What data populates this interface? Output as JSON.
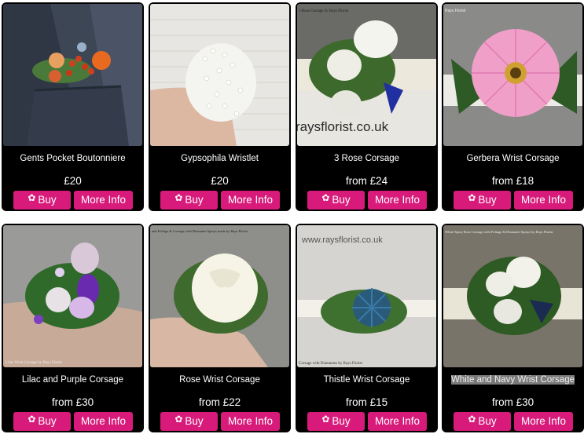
{
  "colors": {
    "accent": "#d81b7b",
    "card": "#000000",
    "text": "#ffffff"
  },
  "products": [
    {
      "name": "Gents Pocket Boutonniere",
      "price": "£20",
      "buy_label": "Buy",
      "info_label": "More Info",
      "buy_icon": "flower-cart-icon",
      "image_caption": ""
    },
    {
      "name": "Gypsophila Wristlet",
      "price": "£20",
      "buy_label": "Buy",
      "info_label": "More Info",
      "buy_icon": "flower-cart-icon",
      "image_caption": ""
    },
    {
      "name": "3 Rose Corsage",
      "price": "from £24",
      "buy_label": "Buy",
      "info_label": "More Info",
      "buy_icon": "flower-cart-icon",
      "image_caption": "3 Rose Corsage by Rays Florist",
      "watermark": "raysflorist.co.uk"
    },
    {
      "name": "Gerbera Wrist Corsage",
      "price": "from £18",
      "buy_label": "Buy",
      "info_label": "More Info",
      "buy_icon": "flower-cart-icon",
      "image_caption": "Rays Florist"
    },
    {
      "name": "Lilac and Purple Corsage",
      "price": "from £30",
      "buy_label": "Buy",
      "info_label": "More Info",
      "buy_icon": "flower-cart-icon",
      "image_caption": "Lilac Wrist Corsage by Rays Florist"
    },
    {
      "name": "Rose Wrist Corsage",
      "price": "from £22",
      "buy_label": "Buy",
      "info_label": "More Info",
      "buy_icon": "flower-cart-icon",
      "image_caption": "and Foliage & Corsage with Diamante Sprays made by Rays Florist"
    },
    {
      "name": "Thistle Wrist Corsage",
      "price": "from £15",
      "buy_label": "Buy",
      "info_label": "More Info",
      "buy_icon": "flower-cart-icon",
      "image_caption": "www.raysflorist.co.uk",
      "image_caption2": "Corsage with Diamantes by Rays Florist"
    },
    {
      "name": "White and Navy Wrist Corsage",
      "price": "from £30",
      "buy_label": "Buy",
      "info_label": "More Info",
      "buy_icon": "flower-cart-icon",
      "image_caption": "White Spray Rose Corsage with Foliage & Diamante Sprays by Rays Florist",
      "highlighted": true
    }
  ]
}
